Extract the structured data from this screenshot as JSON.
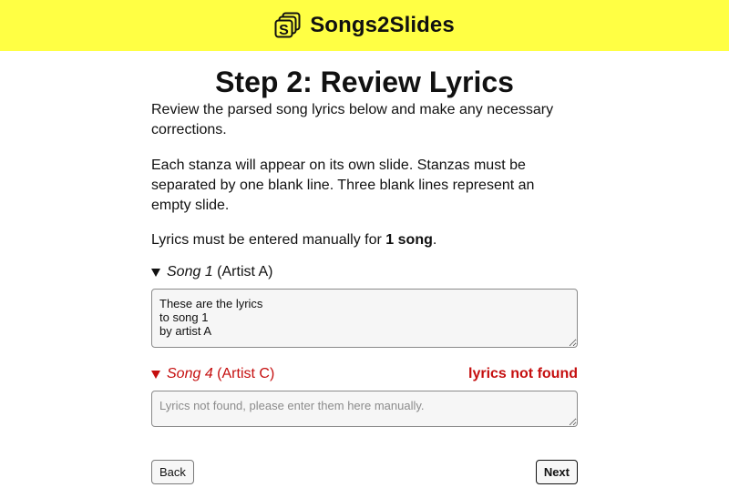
{
  "header": {
    "logo_icon": "stacked-slides-s-icon",
    "app_name": "Songs2Slides",
    "background": "#ffff44"
  },
  "page": {
    "title": "Step 2: Review Lyrics",
    "intro": "Review the parsed song lyrics below and make any necessary corrections.",
    "stanza_note": "Each stanza will appear on its own slide. Stanzas must be separated by one blank line. Three blank lines represent an empty slide.",
    "manual_prefix": "Lyrics must be entered manually for ",
    "manual_count": "1 song",
    "manual_suffix": "."
  },
  "songs": [
    {
      "title": "Song 1",
      "artist": "(Artist A)",
      "lyrics": "These are the lyrics\nto song 1\nby artist A",
      "placeholder": "",
      "warning": "",
      "expanded": true
    },
    {
      "title": "Song 4",
      "artist": "(Artist C)",
      "lyrics": "",
      "placeholder": "Lyrics not found, please enter them here manually.",
      "warning": "lyrics not found",
      "expanded": true,
      "error_color": "#c50f0f"
    }
  ],
  "buttons": {
    "back": "Back",
    "next": "Next"
  }
}
